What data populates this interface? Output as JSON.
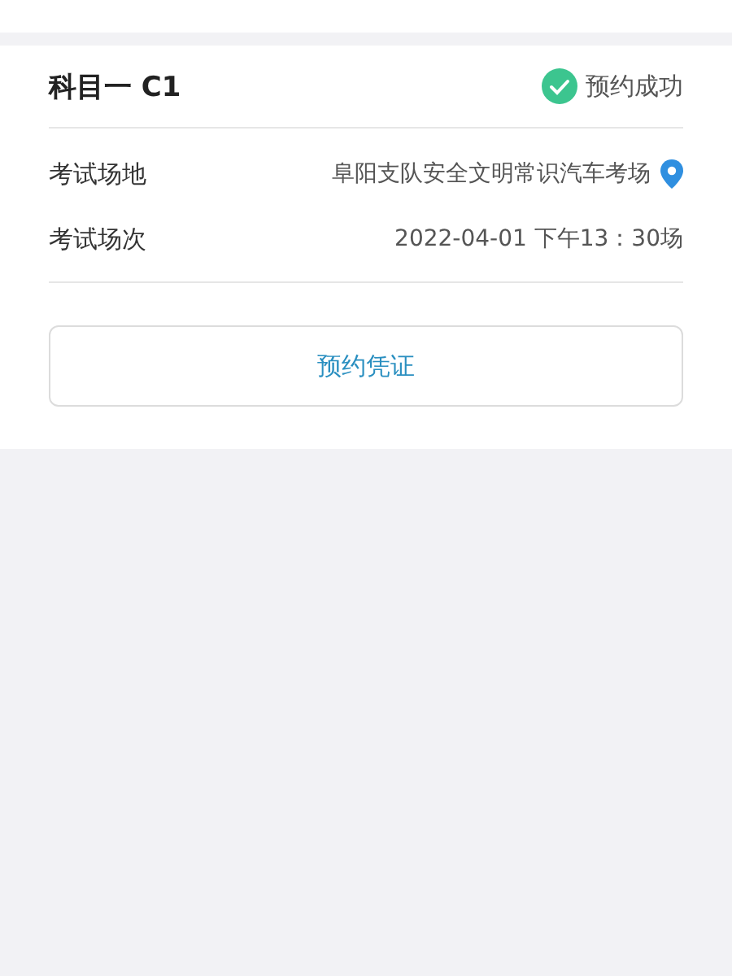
{
  "subject": {
    "title": "科目一 C1",
    "status": {
      "label": "预约成功",
      "done": true
    }
  },
  "details": [
    {
      "label": "考试场地",
      "value": "阜阳支队安全文明常识汽车考场",
      "kind": "location"
    },
    {
      "label": "考试场次",
      "value": "2022-04-01 下午13：30场",
      "kind": "text"
    }
  ],
  "button": "预约凭证"
}
